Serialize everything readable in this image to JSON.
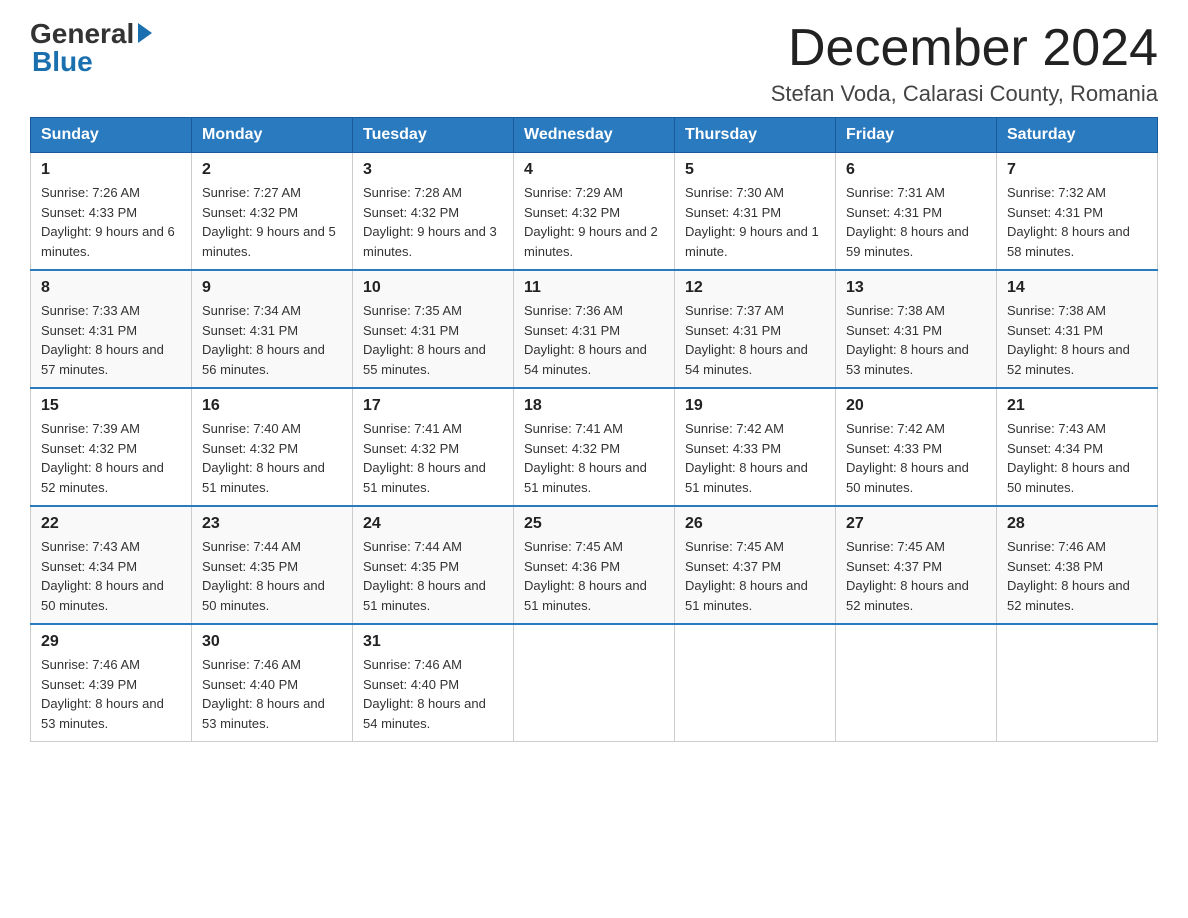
{
  "logo": {
    "general": "General",
    "blue": "Blue"
  },
  "header": {
    "month_year": "December 2024",
    "location": "Stefan Voda, Calarasi County, Romania"
  },
  "weekdays": [
    "Sunday",
    "Monday",
    "Tuesday",
    "Wednesday",
    "Thursday",
    "Friday",
    "Saturday"
  ],
  "weeks": [
    [
      {
        "day": "1",
        "sunrise": "7:26 AM",
        "sunset": "4:33 PM",
        "daylight": "9 hours and 6 minutes."
      },
      {
        "day": "2",
        "sunrise": "7:27 AM",
        "sunset": "4:32 PM",
        "daylight": "9 hours and 5 minutes."
      },
      {
        "day": "3",
        "sunrise": "7:28 AM",
        "sunset": "4:32 PM",
        "daylight": "9 hours and 3 minutes."
      },
      {
        "day": "4",
        "sunrise": "7:29 AM",
        "sunset": "4:32 PM",
        "daylight": "9 hours and 2 minutes."
      },
      {
        "day": "5",
        "sunrise": "7:30 AM",
        "sunset": "4:31 PM",
        "daylight": "9 hours and 1 minute."
      },
      {
        "day": "6",
        "sunrise": "7:31 AM",
        "sunset": "4:31 PM",
        "daylight": "8 hours and 59 minutes."
      },
      {
        "day": "7",
        "sunrise": "7:32 AM",
        "sunset": "4:31 PM",
        "daylight": "8 hours and 58 minutes."
      }
    ],
    [
      {
        "day": "8",
        "sunrise": "7:33 AM",
        "sunset": "4:31 PM",
        "daylight": "8 hours and 57 minutes."
      },
      {
        "day": "9",
        "sunrise": "7:34 AM",
        "sunset": "4:31 PM",
        "daylight": "8 hours and 56 minutes."
      },
      {
        "day": "10",
        "sunrise": "7:35 AM",
        "sunset": "4:31 PM",
        "daylight": "8 hours and 55 minutes."
      },
      {
        "day": "11",
        "sunrise": "7:36 AM",
        "sunset": "4:31 PM",
        "daylight": "8 hours and 54 minutes."
      },
      {
        "day": "12",
        "sunrise": "7:37 AM",
        "sunset": "4:31 PM",
        "daylight": "8 hours and 54 minutes."
      },
      {
        "day": "13",
        "sunrise": "7:38 AM",
        "sunset": "4:31 PM",
        "daylight": "8 hours and 53 minutes."
      },
      {
        "day": "14",
        "sunrise": "7:38 AM",
        "sunset": "4:31 PM",
        "daylight": "8 hours and 52 minutes."
      }
    ],
    [
      {
        "day": "15",
        "sunrise": "7:39 AM",
        "sunset": "4:32 PM",
        "daylight": "8 hours and 52 minutes."
      },
      {
        "day": "16",
        "sunrise": "7:40 AM",
        "sunset": "4:32 PM",
        "daylight": "8 hours and 51 minutes."
      },
      {
        "day": "17",
        "sunrise": "7:41 AM",
        "sunset": "4:32 PM",
        "daylight": "8 hours and 51 minutes."
      },
      {
        "day": "18",
        "sunrise": "7:41 AM",
        "sunset": "4:32 PM",
        "daylight": "8 hours and 51 minutes."
      },
      {
        "day": "19",
        "sunrise": "7:42 AM",
        "sunset": "4:33 PM",
        "daylight": "8 hours and 51 minutes."
      },
      {
        "day": "20",
        "sunrise": "7:42 AM",
        "sunset": "4:33 PM",
        "daylight": "8 hours and 50 minutes."
      },
      {
        "day": "21",
        "sunrise": "7:43 AM",
        "sunset": "4:34 PM",
        "daylight": "8 hours and 50 minutes."
      }
    ],
    [
      {
        "day": "22",
        "sunrise": "7:43 AM",
        "sunset": "4:34 PM",
        "daylight": "8 hours and 50 minutes."
      },
      {
        "day": "23",
        "sunrise": "7:44 AM",
        "sunset": "4:35 PM",
        "daylight": "8 hours and 50 minutes."
      },
      {
        "day": "24",
        "sunrise": "7:44 AM",
        "sunset": "4:35 PM",
        "daylight": "8 hours and 51 minutes."
      },
      {
        "day": "25",
        "sunrise": "7:45 AM",
        "sunset": "4:36 PM",
        "daylight": "8 hours and 51 minutes."
      },
      {
        "day": "26",
        "sunrise": "7:45 AM",
        "sunset": "4:37 PM",
        "daylight": "8 hours and 51 minutes."
      },
      {
        "day": "27",
        "sunrise": "7:45 AM",
        "sunset": "4:37 PM",
        "daylight": "8 hours and 52 minutes."
      },
      {
        "day": "28",
        "sunrise": "7:46 AM",
        "sunset": "4:38 PM",
        "daylight": "8 hours and 52 minutes."
      }
    ],
    [
      {
        "day": "29",
        "sunrise": "7:46 AM",
        "sunset": "4:39 PM",
        "daylight": "8 hours and 53 minutes."
      },
      {
        "day": "30",
        "sunrise": "7:46 AM",
        "sunset": "4:40 PM",
        "daylight": "8 hours and 53 minutes."
      },
      {
        "day": "31",
        "sunrise": "7:46 AM",
        "sunset": "4:40 PM",
        "daylight": "8 hours and 54 minutes."
      },
      null,
      null,
      null,
      null
    ]
  ],
  "labels": {
    "sunrise": "Sunrise:",
    "sunset": "Sunset:",
    "daylight": "Daylight:"
  }
}
